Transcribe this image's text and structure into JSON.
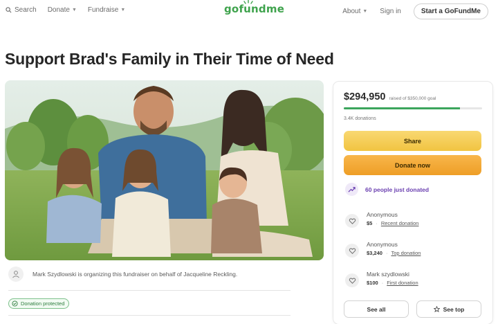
{
  "header": {
    "search_label": "Search",
    "donate_label": "Donate",
    "fundraise_label": "Fundraise",
    "logo_text": "gofundme",
    "about_label": "About",
    "signin_label": "Sign in",
    "start_label": "Start a GoFundMe"
  },
  "page": {
    "title": "Support Brad's Family in Their Time of Need"
  },
  "organizer": {
    "text": "Mark Szydlowski is organizing this fundraiser on behalf of Jacqueline Reckling.",
    "protected_label": "Donation protected"
  },
  "card": {
    "raised": "$294,950",
    "goal_text": "raised of $350,000 goal",
    "progress_fraction": 0.84,
    "donations_count": "3.4K donations",
    "share_label": "Share",
    "donate_label": "Donate now",
    "just_donated": "60 people just donated",
    "donors": [
      {
        "name": "Anonymous",
        "amount": "$5",
        "tag": "Recent donation"
      },
      {
        "name": "Anonymous",
        "amount": "$3,240",
        "tag": "Top donation"
      },
      {
        "name": "Mark szydlowski",
        "amount": "$100",
        "tag": "First donation"
      }
    ],
    "see_all_label": "See all",
    "see_top_label": "See top"
  },
  "colors": {
    "brand_green": "#3fa34d",
    "progress_green": "#3ba55c",
    "share_yellow": "#f1c441",
    "donate_orange": "#ee9e26",
    "accent_purple": "#6a3fb0"
  }
}
